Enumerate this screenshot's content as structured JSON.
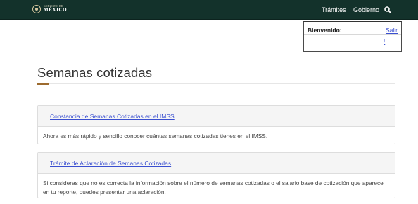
{
  "header": {
    "logo_small": "GOBIERNO DE",
    "logo_big": "MÉXICO",
    "nav": [
      {
        "label": "Trámites"
      },
      {
        "label": "Gobierno"
      }
    ],
    "search_icon": "search-icon",
    "background_color": "#13322b"
  },
  "welcome": {
    "label": "Bienvenido:",
    "logout": "Salir",
    "mark": "!"
  },
  "page": {
    "title": "Semanas cotizadas",
    "accent_color": "#9d6b2f"
  },
  "cards": [
    {
      "link": "Constancia de Semanas Cotizadas en el IMSS",
      "description": "Ahora es más rápido y sencillo conocer cuántas semanas cotizadas tienes en el IMSS."
    },
    {
      "link": "Trámite de Aclaración de Semanas Cotizadas",
      "description": "Si consideras que no es correcta la información sobre el número de semanas cotizadas o el salario base de cotización que aparece en tu reporte, puedes presentar una aclaración."
    }
  ],
  "link_color": "#3a4fd0"
}
